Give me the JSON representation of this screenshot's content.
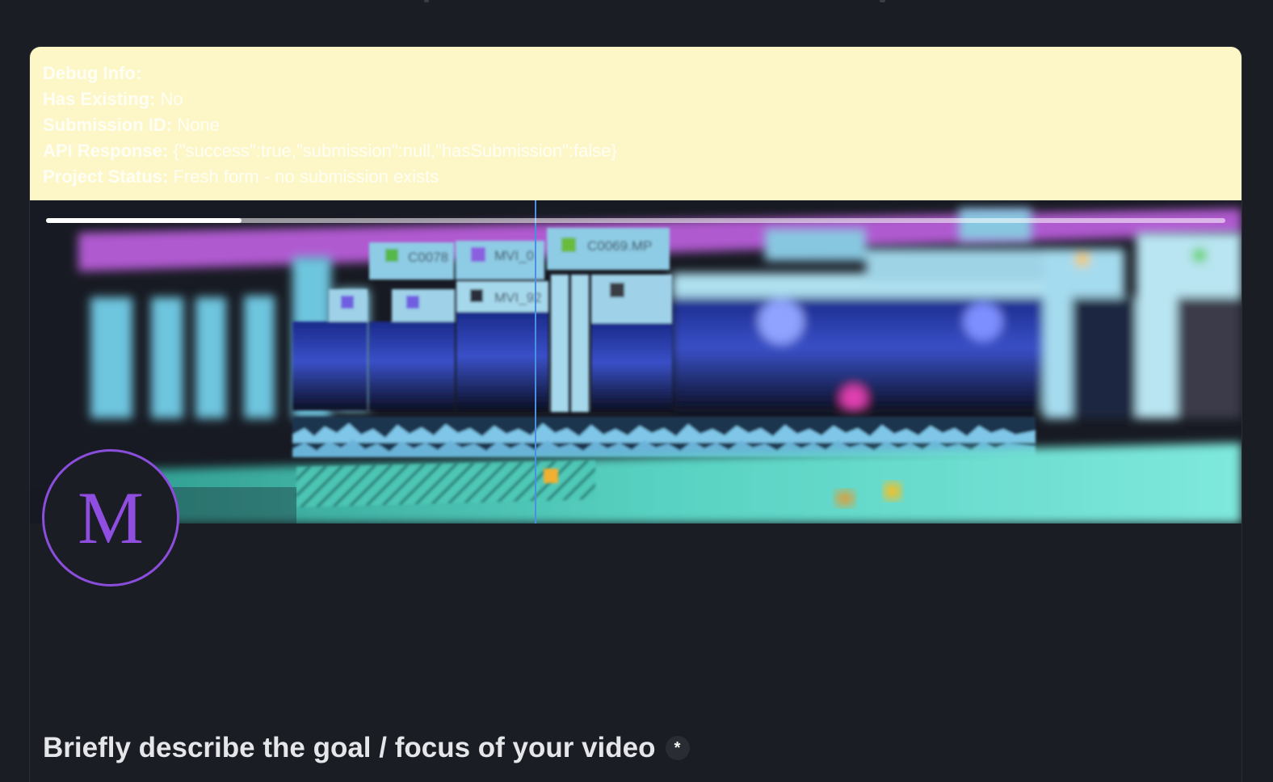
{
  "debug": {
    "title": "Debug Info:",
    "rows": [
      {
        "key": "Has Existing:",
        "value": "No"
      },
      {
        "key": "Submission ID:",
        "value": "None"
      },
      {
        "key": "API Response:",
        "value": "{\"success\":true,\"submission\":null,\"hasSubmission\":false}"
      },
      {
        "key": "Project Status:",
        "value": "Fresh form - no submission exists"
      }
    ]
  },
  "banner": {
    "progress": 0.166,
    "clip_labels": [
      "C0078",
      "MVI_0",
      "C0069.MP",
      "MVI_92"
    ]
  },
  "logo": {
    "letter": "M"
  },
  "form": {
    "question": "Briefly describe the goal / focus of your video",
    "required_marker": "*"
  },
  "colors": {
    "background": "#1b1d24",
    "debug_background": "#fdf7c8",
    "accent_purple": "#8b4ddb",
    "playhead": "#4a90e2"
  }
}
